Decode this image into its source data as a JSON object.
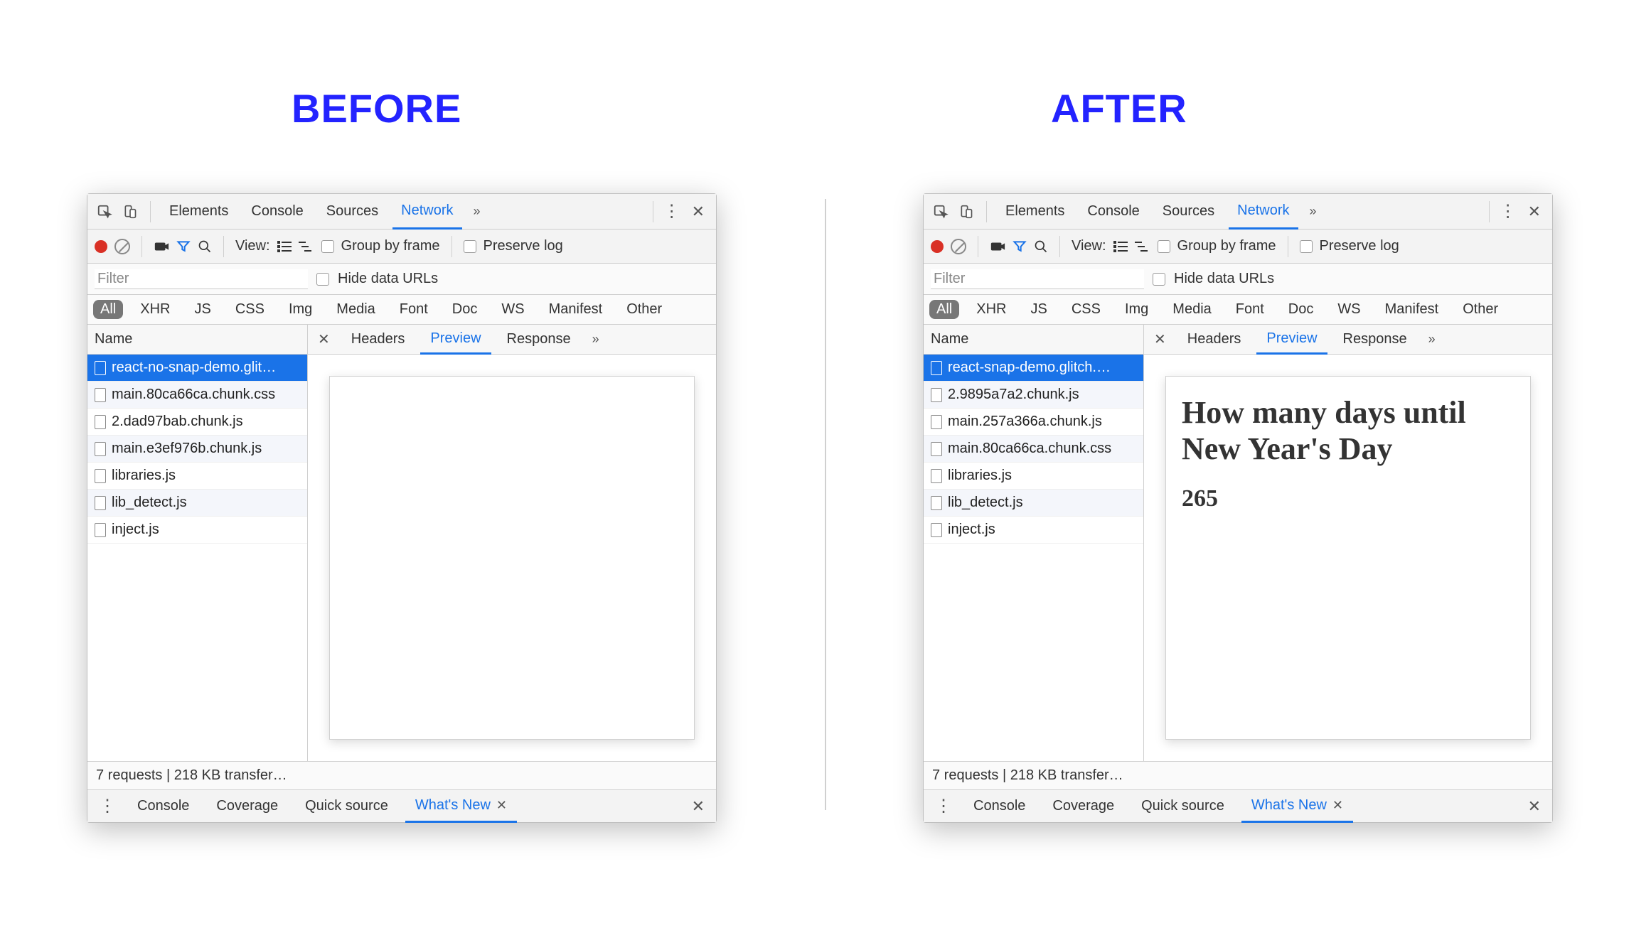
{
  "headings": {
    "before": "BEFORE",
    "after": "AFTER"
  },
  "topTabs": {
    "items": [
      "Elements",
      "Console",
      "Sources",
      "Network"
    ],
    "active": "Network",
    "moreGlyph": "»"
  },
  "toolbar": {
    "viewLabel": "View:",
    "groupByFrame": "Group by frame",
    "preserveLog": "Preserve log"
  },
  "filterRow": {
    "placeholder": "Filter",
    "hideDataUrls": "Hide data URLs"
  },
  "typeFilters": {
    "items": [
      "All",
      "XHR",
      "JS",
      "CSS",
      "Img",
      "Media",
      "Font",
      "Doc",
      "WS",
      "Manifest",
      "Other"
    ],
    "active": "All"
  },
  "requestsHeader": "Name",
  "detailTabs": {
    "items": [
      "Headers",
      "Preview",
      "Response"
    ],
    "active": "Preview",
    "moreGlyph": "»"
  },
  "status": "7 requests | 218 KB transfer…",
  "drawerTabs": {
    "items": [
      "Console",
      "Coverage",
      "Quick source",
      "What's New"
    ],
    "active": "What's New"
  },
  "panels": {
    "before": {
      "requests": [
        "react-no-snap-demo.glit…",
        "main.80ca66ca.chunk.css",
        "2.dad97bab.chunk.js",
        "main.e3ef976b.chunk.js",
        "libraries.js",
        "lib_detect.js",
        "inject.js"
      ],
      "selectedIndex": 0,
      "preview": {
        "title": "",
        "count": ""
      }
    },
    "after": {
      "requests": [
        "react-snap-demo.glitch.…",
        "2.9895a7a2.chunk.js",
        "main.257a366a.chunk.js",
        "main.80ca66ca.chunk.css",
        "libraries.js",
        "lib_detect.js",
        "inject.js"
      ],
      "selectedIndex": 0,
      "preview": {
        "title": "How many days until New Year's Day",
        "count": "265"
      }
    }
  }
}
